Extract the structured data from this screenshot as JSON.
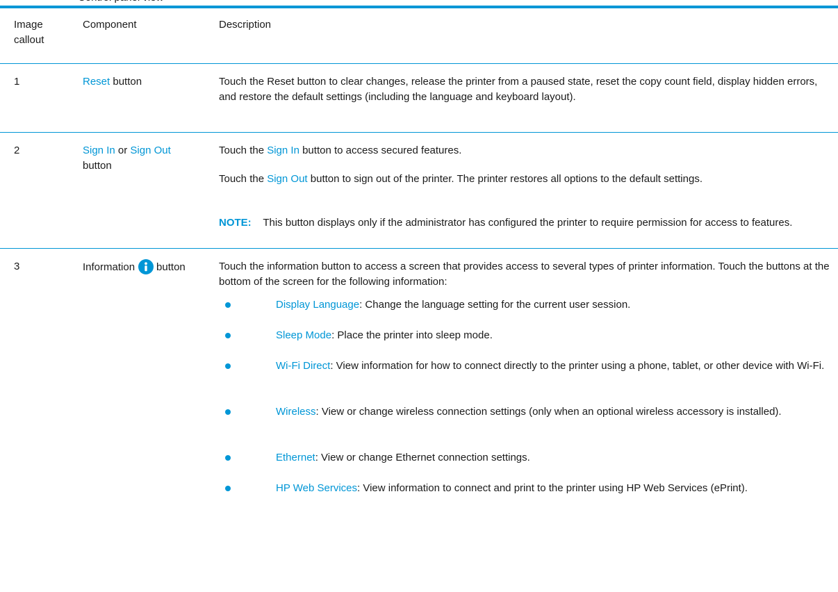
{
  "section_title": "Control panel view",
  "header": {
    "col1_line1": "Image",
    "col1_line2": "callout",
    "col2": "Component",
    "col3": "Description"
  },
  "rows": [
    {
      "callout": "1",
      "component": {
        "link": "Reset",
        "suffix": " button"
      },
      "description": "Touch the Reset button to clear changes, release the printer from a paused state, reset the copy count field, display hidden errors, and restore the default settings (including the language and keyboard layout)."
    },
    {
      "callout": "2",
      "component": {
        "link1": "Sign In",
        "middle": " or ",
        "link2": "Sign Out",
        "suffix": "button"
      },
      "p1": {
        "prefix": "Touch the ",
        "link": "Sign In",
        "suffix": " button to access secured features."
      },
      "p2": {
        "prefix": "Touch the ",
        "link": "Sign Out",
        "suffix": " button to sign out of the printer. The printer restores all options to the default settings."
      },
      "note": {
        "label": "NOTE:",
        "text": "This button displays only if the administrator has configured the printer to require permission for access to features."
      }
    },
    {
      "callout": "3",
      "component": {
        "prefix": "Information",
        "icon": "info-icon",
        "suffix": "button"
      },
      "intro": "Touch the information button to access a screen that provides access to several types of printer information. Touch the buttons at the bottom of the screen for the following information:",
      "bullets": [
        {
          "link": "Display Language",
          "text": ": Change the language setting for the current user session."
        },
        {
          "link": "Sleep Mode",
          "text": ": Place the printer into sleep mode."
        },
        {
          "link": "Wi-Fi Direct",
          "text": ": View information for how to connect directly to the printer using a phone, tablet, or other device with Wi-Fi."
        },
        {
          "link": "Wireless",
          "text": ": View or change wireless connection settings (only when an optional wireless accessory is installed)."
        },
        {
          "link": "Ethernet",
          "text": ": View or change Ethernet connection settings."
        },
        {
          "link": "HP Web Services",
          "text": ": View information to connect and print to the printer using HP Web Services (ePrint)."
        }
      ]
    }
  ],
  "colors": {
    "accent": "#0096d6",
    "text": "#1a1a1a"
  }
}
